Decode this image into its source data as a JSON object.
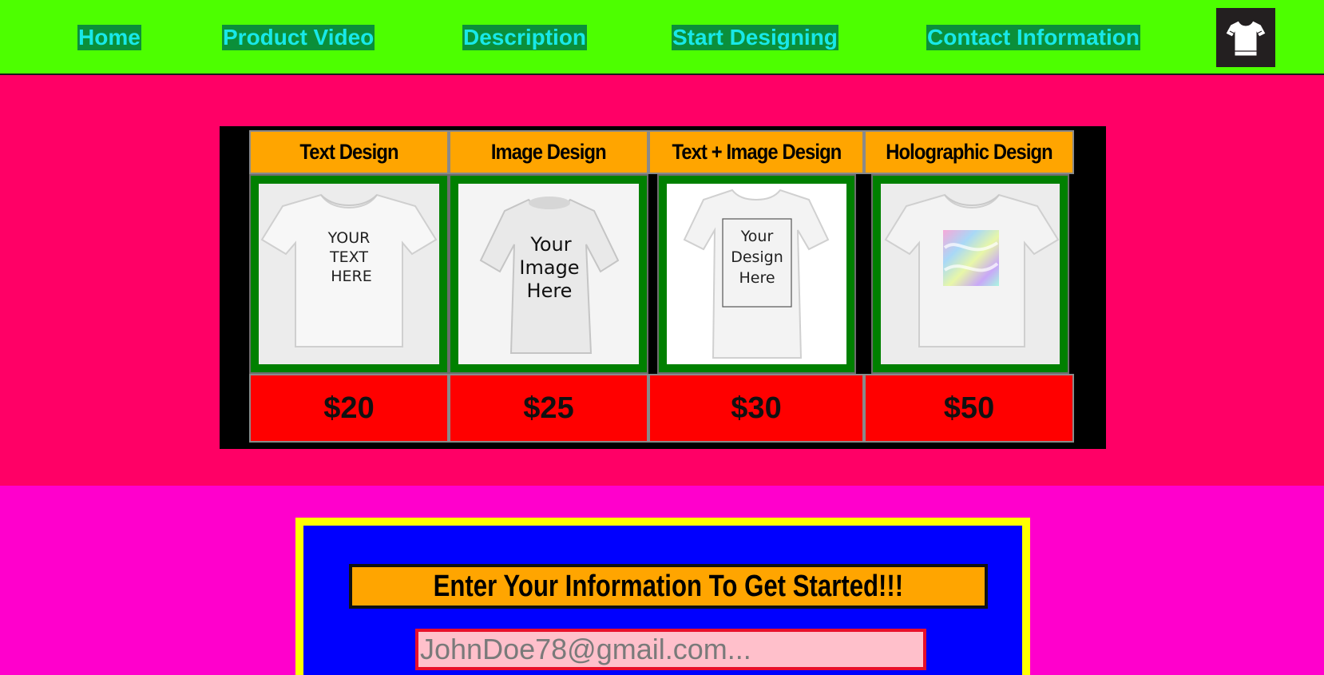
{
  "nav": {
    "home": "Home",
    "product_video": "Product Video",
    "description": "Description",
    "start_designing": "Start Designing",
    "contact_information": "Contact Information",
    "logo_icon": "tshirt-icon"
  },
  "products": {
    "headers": [
      "Text Design",
      "Image Design",
      "Text + Image Design",
      "Holographic Design"
    ],
    "images": [
      {
        "icon": "tshirt-text-mockup",
        "lines": [
          "YOUR",
          "TEXT",
          "HERE"
        ]
      },
      {
        "icon": "tshirt-image-mockup",
        "lines": [
          "Your",
          "Image",
          "Here"
        ]
      },
      {
        "icon": "tshirt-design-mockup",
        "lines": [
          "Your",
          "Design",
          "Here"
        ]
      },
      {
        "icon": "tshirt-holographic-mockup",
        "lines": []
      }
    ],
    "prices": [
      "$20",
      "$25",
      "$30",
      "$50"
    ]
  },
  "form": {
    "title": "Enter Your Information To Get Started!!!",
    "email_placeholder": "JohnDoe78@gmail.com..."
  },
  "colors": {
    "nav_bg": "#4dff00",
    "nav_link_bg": "#0b8f3a",
    "nav_link_text": "#18e8e8",
    "products_bg": "#ff0066",
    "header_bg": "#ffa500",
    "image_frame": "#008000",
    "price_bg": "#ff0000",
    "form_section_bg": "#ff00cc",
    "form_border": "#ffff00",
    "form_bg": "#0000ff",
    "email_bg": "#ffc0cb"
  }
}
